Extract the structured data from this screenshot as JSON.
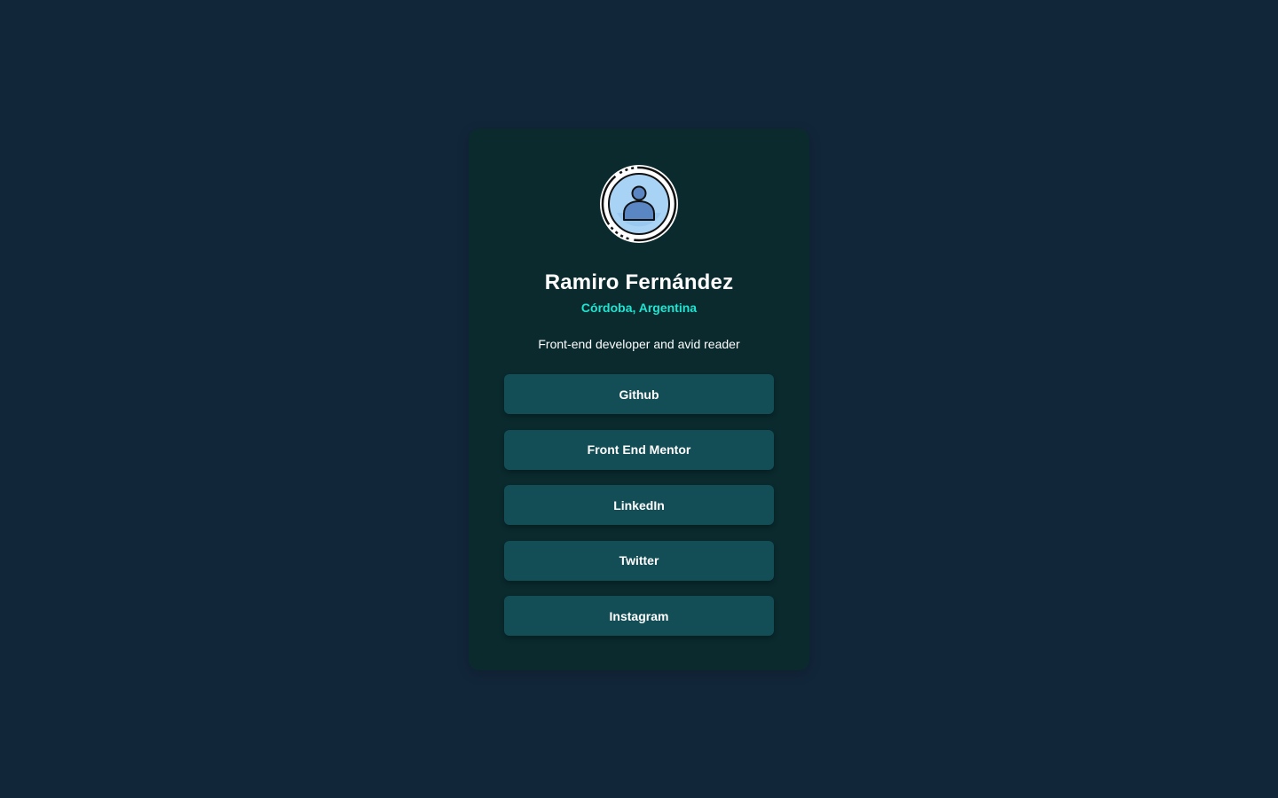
{
  "profile": {
    "avatar_icon": "user-avatar-icon",
    "name": "Ramiro Fernández",
    "location": "Córdoba, Argentina",
    "bio": "Front-end developer and avid reader"
  },
  "links": [
    {
      "label": "Github"
    },
    {
      "label": "Front End Mentor"
    },
    {
      "label": "LinkedIn"
    },
    {
      "label": "Twitter"
    },
    {
      "label": "Instagram"
    }
  ],
  "colors": {
    "background": "#12263a",
    "card": "#0a2a2e",
    "button": "#134e57",
    "accent": "#1de5d1",
    "text": "#ffffff"
  }
}
